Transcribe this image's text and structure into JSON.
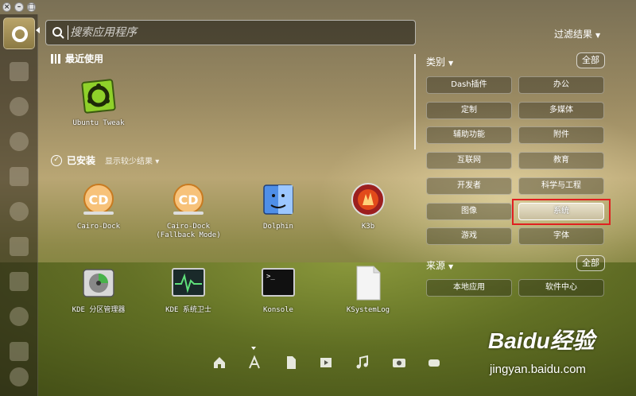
{
  "search": {
    "placeholder": "搜索应用程序"
  },
  "filter_toggle": {
    "label": "过滤结果"
  },
  "sections": {
    "recent": {
      "title": "最近使用"
    },
    "installed": {
      "title": "已安装",
      "more": "显示较少结果"
    }
  },
  "recent_apps": [
    {
      "name": "Ubuntu Tweak",
      "icon": "ubuntu-tweak-icon"
    }
  ],
  "installed_apps": [
    {
      "name": "Cairo-Dock",
      "icon": "cairo-dock-icon"
    },
    {
      "name": "Cairo-Dock\n(Fallback Mode)",
      "icon": "cairo-dock-fallback-icon"
    },
    {
      "name": "Dolphin",
      "icon": "dolphin-icon"
    },
    {
      "name": "K3b",
      "icon": "k3b-icon"
    },
    {
      "name": "KDE 分区管理器",
      "icon": "partition-manager-icon"
    },
    {
      "name": "KDE 系统卫士",
      "icon": "system-monitor-icon"
    },
    {
      "name": "Konsole",
      "icon": "konsole-icon"
    },
    {
      "name": "KSystemLog",
      "icon": "ksystemlog-icon"
    }
  ],
  "filters": {
    "category": {
      "title": "类别",
      "all": "全部",
      "items": [
        "Dash插件",
        "办公",
        "定制",
        "多媒体",
        "辅助功能",
        "附件",
        "互联网",
        "教育",
        "开发者",
        "科学与工程",
        "图像",
        "系统",
        "游戏",
        "字体"
      ],
      "selected": "系统"
    },
    "source": {
      "title": "来源",
      "all": "全部",
      "items": [
        "本地应用",
        "软件中心"
      ]
    }
  },
  "lenses": [
    "home-lens-icon",
    "applications-lens-icon",
    "files-lens-icon",
    "video-lens-icon",
    "music-lens-icon",
    "photo-lens-icon",
    "social-lens-icon"
  ],
  "watermark": {
    "brand": "Baidu经验",
    "url": "jingyan.baidu.com"
  },
  "colors": {
    "highlight": "#e02020",
    "panel": "#1e1c14"
  }
}
